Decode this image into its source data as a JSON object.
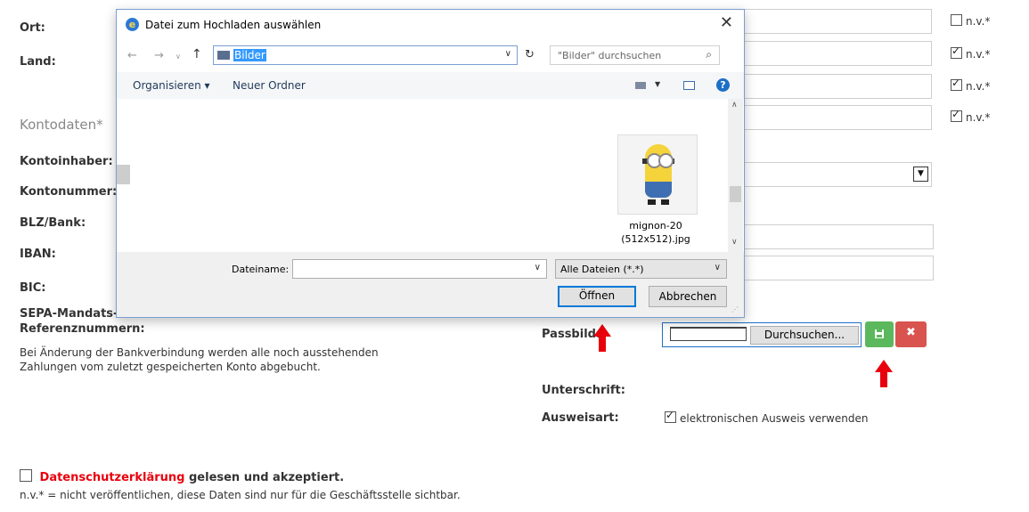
{
  "form": {
    "ort_label": "Ort:",
    "land_label": "Land:",
    "kontodaten_heading": "Kontodaten*",
    "kontoinhaber_label": "Kontoinhaber:",
    "kontonummer_label": "Kontonummer:",
    "blz_label": "BLZ/Bank:",
    "iban_label": "IBAN:",
    "bic_label": "BIC:",
    "sepa_label_1": "SEPA-Mandats-",
    "sepa_label_2": "Referenznummern:",
    "bank_note_1": "Bei Änderung der Bankverbindung werden alle noch ausstehenden",
    "bank_note_2": "Zahlungen vom zuletzt gespeicherten Konto abgebucht.",
    "passbild_label": "Passbild:",
    "browse_button": "Durchsuchen...",
    "unterschrift_label": "Unterschrift:",
    "ausweisart_label": "Ausweisart:",
    "ausweis_checkbox_label": "elektronischen Ausweis verwenden",
    "privacy_link": "Datenschutzerklärung",
    "privacy_rest": "gelesen und akzeptiert.",
    "footnote": "n.v.* = nicht veröffentlichen, diese Daten sind nur für die Geschäftsstelle sichtbar.",
    "nv_items": [
      {
        "label": "n.v.*",
        "checked": false
      },
      {
        "label": "n.v.*",
        "checked": true
      },
      {
        "label": "n.v.*",
        "checked": true
      },
      {
        "label": "n.v.*",
        "checked": true
      }
    ]
  },
  "dialog": {
    "title": "Datei zum Hochladen auswählen",
    "address_value": "Bilder",
    "search_placeholder": "\"Bilder\" durchsuchen",
    "organize_label": "Organisieren ▾",
    "new_folder_label": "Neuer Ordner",
    "file_name_line1": "mignon-20",
    "file_name_line2": "(512x512).jpg",
    "filename_label": "Dateiname:",
    "filename_value": "",
    "filetype_value": "Alle Dateien (*.*)",
    "open_button": "Öffnen",
    "cancel_button": "Abbrechen"
  },
  "colors": {
    "save_button": "#5cb85c",
    "delete_button": "#d9534f",
    "arrow": "#e8000d",
    "privacy_link": "#e8000d"
  }
}
